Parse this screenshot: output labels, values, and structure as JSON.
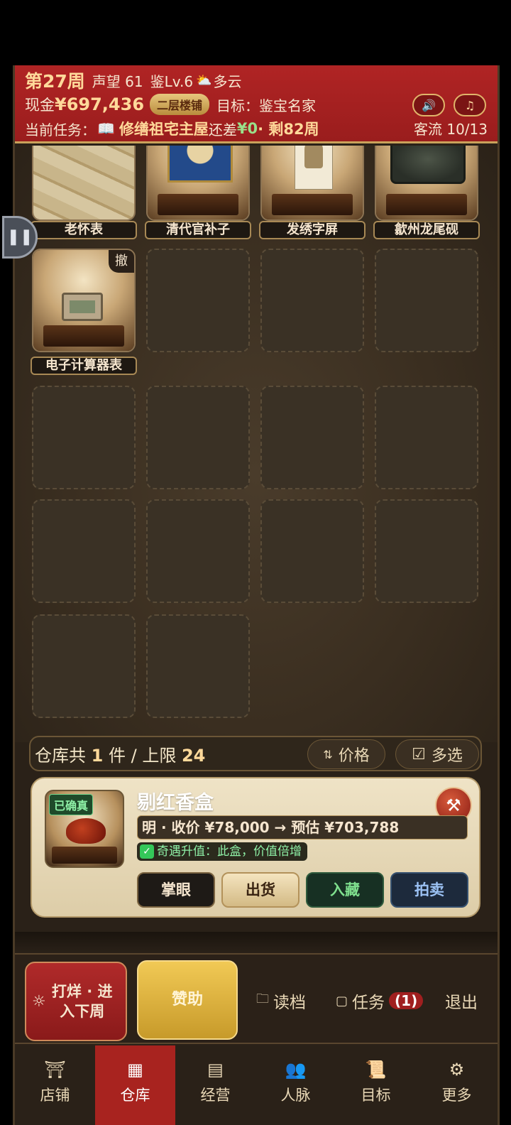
{
  "header": {
    "week": "第27周",
    "reputation": "声望 61",
    "appraisal": "鉴Lv.6",
    "weather_icon": "partly-cloudy-icon",
    "weather": "多云",
    "cash_label": "现金",
    "cash": "¥697,436",
    "shop_level": "二层楼铺",
    "goal": "目标：鉴宝名家",
    "task_label": "当前任务：",
    "task_icon": "book-icon",
    "task_name": "修缮祖宅主屋",
    "task_remaining_label": "还差",
    "task_remaining": "¥0",
    "task_weeks": "· 剩82周",
    "traffic": "客流 10/13"
  },
  "grid": {
    "items": [
      {
        "label": "老怀表"
      },
      {
        "label": "清代官补子"
      },
      {
        "label": "发绣字屏"
      },
      {
        "label": "歙州龙尾砚"
      },
      {
        "label": "电子计算器表",
        "withdraw": "撤"
      }
    ]
  },
  "warehouse": {
    "count_prefix": "仓库共",
    "count": "1",
    "count_mid": "件 / 上限",
    "limit": "24",
    "sort_label": "价格",
    "sort_icon": "⇅",
    "multi_label": "多选",
    "multi_icon": "☑"
  },
  "detail": {
    "verified": "已确真",
    "name": "剔红香盒",
    "price_line": "明 · 收价 ¥78,000 → 预估 ¥703,788",
    "bonus": "奇遇升值：此盒，价值倍增",
    "buttons": {
      "appraise": "掌眼",
      "ship": "出货",
      "collect": "入藏",
      "auction": "拍卖"
    }
  },
  "actions": {
    "next_week": "打烊 · 进入下周",
    "sponsor": "赞助",
    "load": "读档",
    "tasks": "任务",
    "tasks_badge": "(1)",
    "exit": "退出"
  },
  "tabs": [
    {
      "label": "店铺",
      "icon": "shop-icon"
    },
    {
      "label": "仓库",
      "icon": "warehouse-icon"
    },
    {
      "label": "经营",
      "icon": "abacus-icon"
    },
    {
      "label": "人脉",
      "icon": "people-icon"
    },
    {
      "label": "目标",
      "icon": "scroll-icon"
    },
    {
      "label": "更多",
      "icon": "more-icon"
    }
  ],
  "colors": {
    "header_red": "#b02424",
    "gold": "#ffd99a",
    "active_tab": "#a8231f",
    "green": "#8ef0a6"
  }
}
